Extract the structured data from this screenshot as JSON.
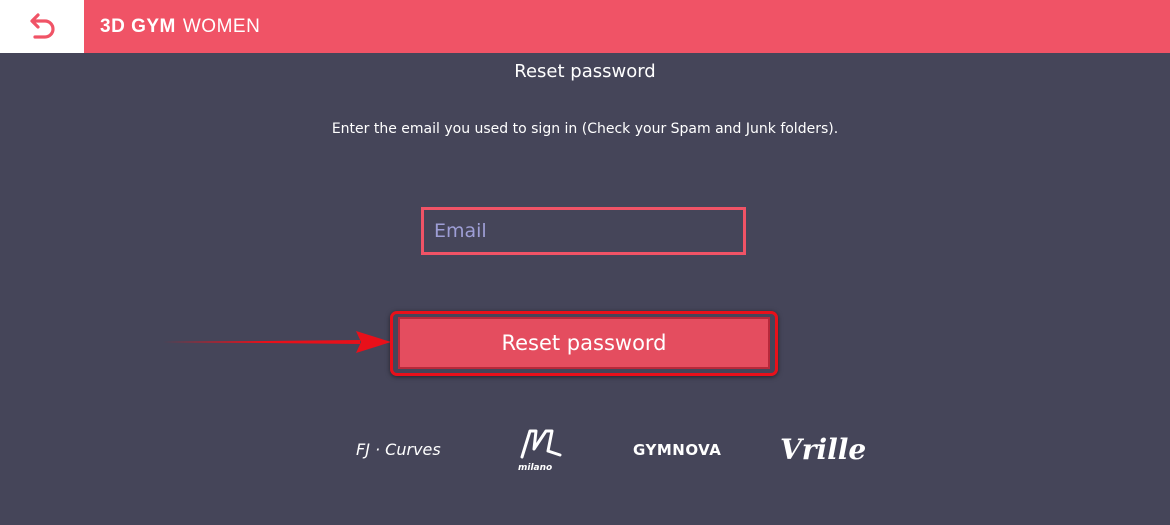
{
  "header": {
    "back_icon": "back-arrow-icon",
    "brand_bold": "3D GYM",
    "brand_light": "WOMEN"
  },
  "main": {
    "title": "Reset password",
    "instructions": "Enter the email you used to sign in (Check your Spam and Junk folders).",
    "email_placeholder": "Email",
    "email_value": "",
    "reset_button_label": "Reset password"
  },
  "partners": {
    "logos": [
      "FJ · Curves",
      "milano",
      "GYMNOVA",
      "Vrille"
    ]
  },
  "colors": {
    "header": "#f05366",
    "background": "#454559",
    "button": "#e44d5f",
    "highlight": "#e8101a"
  }
}
